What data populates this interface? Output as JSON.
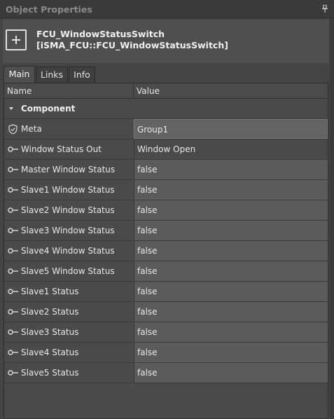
{
  "panel": {
    "title": "Object Properties",
    "pin_icon": "pin-icon"
  },
  "object": {
    "name": "FCU_WindowStatusSwitch",
    "type": "[iSMA_FCU::FCU_WindowStatusSwitch]",
    "icon": "component-plus-icon"
  },
  "tabs": [
    {
      "label": "Main",
      "active": true
    },
    {
      "label": "Links",
      "active": false
    },
    {
      "label": "Info",
      "active": false
    }
  ],
  "table": {
    "headers": {
      "name": "Name",
      "value": "Value"
    },
    "group": "Component",
    "rows": [
      {
        "name": "Meta",
        "value": "Group1",
        "icon": "shield-icon"
      },
      {
        "name": "Window Status Out",
        "value": "Window Open",
        "icon": "slot-icon"
      },
      {
        "name": "Master Window Status",
        "value": "false",
        "icon": "slot-icon"
      },
      {
        "name": "Slave1 Window Status",
        "value": "false",
        "icon": "slot-icon"
      },
      {
        "name": "Slave2 Window Status",
        "value": "false",
        "icon": "slot-icon"
      },
      {
        "name": "Slave3 Window Status",
        "value": "false",
        "icon": "slot-icon"
      },
      {
        "name": "Slave4 Window Status",
        "value": "false",
        "icon": "slot-icon"
      },
      {
        "name": "Slave5 Window Status",
        "value": "false",
        "icon": "slot-icon"
      },
      {
        "name": "Slave1 Status",
        "value": "false",
        "icon": "slot-icon"
      },
      {
        "name": "Slave2 Status",
        "value": "false",
        "icon": "slot-icon"
      },
      {
        "name": "Slave3 Status",
        "value": "false",
        "icon": "slot-icon"
      },
      {
        "name": "Slave4 Status",
        "value": "false",
        "icon": "slot-icon"
      },
      {
        "name": "Slave5 Status",
        "value": "false",
        "icon": "slot-icon"
      }
    ]
  }
}
